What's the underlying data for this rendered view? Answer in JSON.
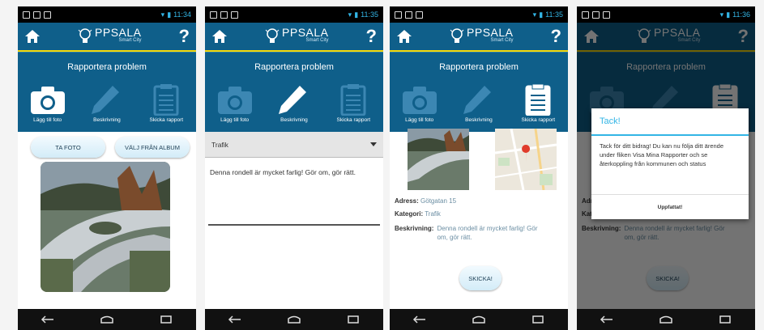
{
  "app": {
    "logo_title": "PPSALA",
    "logo_subtitle": "Smart City",
    "help_label": "?",
    "screen_title": "Rapportera problem"
  },
  "steps": {
    "photo": "Lägg till foto",
    "description": "Beskrivning",
    "send": "Skicka rapport"
  },
  "screens": [
    {
      "time": "11:34",
      "active_step": "photo",
      "take_photo_label": "TA FOTO",
      "choose_album_label": "VÄLJ FRÅN ALBUM"
    },
    {
      "time": "11:35",
      "active_step": "description",
      "category_value": "Trafik",
      "description_value": "Denna rondell är mycket farlig! Gör om, gör rätt."
    },
    {
      "time": "11:35",
      "active_step": "send",
      "address_label": "Adress:",
      "address_value": "Götgatan 15",
      "category_label": "Kategori:",
      "category_value": "Trafik",
      "description_label": "Beskrivning:",
      "description_value": "Denna rondell är mycket farlig! Gör om, gör rätt.",
      "send_button_label": "SKICKA!"
    },
    {
      "time": "11:36",
      "dialog_title": "Tack!",
      "dialog_body": "Tack för ditt bidrag! Du kan nu följa ditt ärende under fliken Visa Mina Rapporter och se återkoppling från kommunen och status",
      "dialog_button_label": "Uppfattat!"
    }
  ],
  "colors": {
    "accent": "#0f5f8a",
    "highlight": "#f5d90a",
    "holo_blue": "#33b5e5"
  },
  "icons": [
    "home-icon",
    "lightbulb-icon",
    "help-icon",
    "camera-icon",
    "pencil-icon",
    "clipboard-icon",
    "back-icon",
    "home-nav-icon",
    "recents-icon"
  ]
}
